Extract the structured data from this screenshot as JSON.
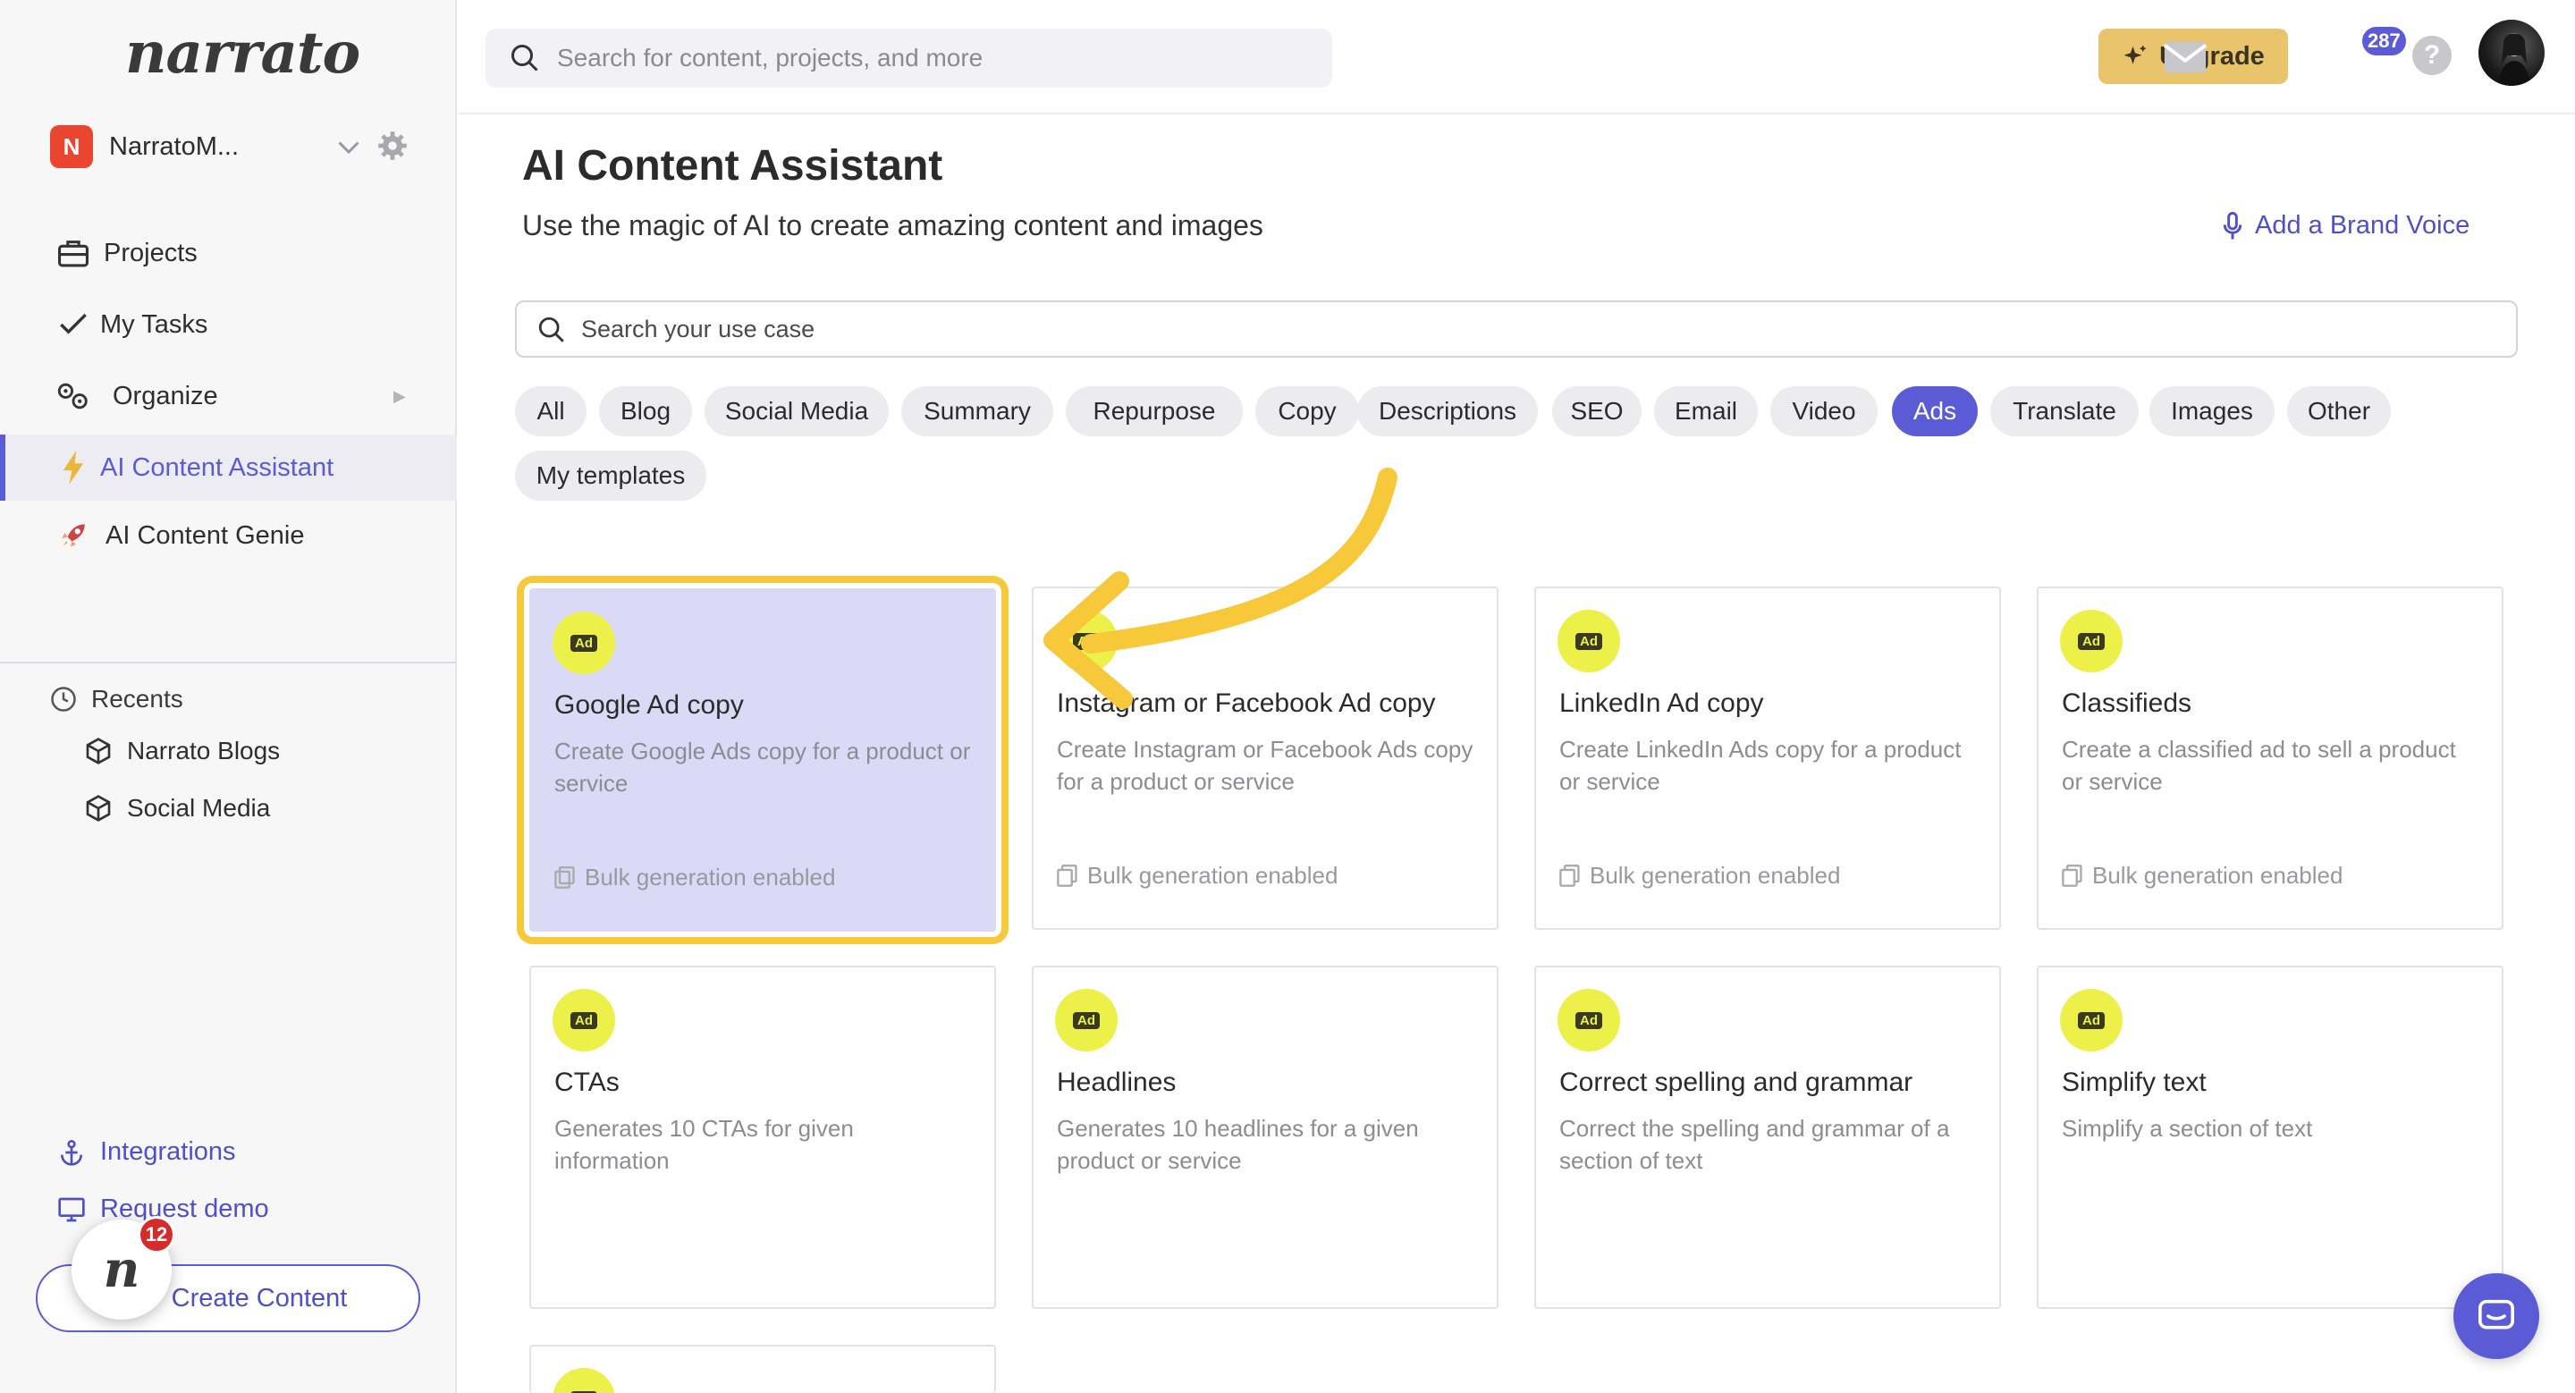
{
  "sidebar": {
    "logo": "narrato",
    "workspace": {
      "initial": "N",
      "name": "NarratoM..."
    },
    "nav": [
      {
        "label": "Projects",
        "icon": "briefcase-icon"
      },
      {
        "label": "My Tasks",
        "icon": "check-icon"
      },
      {
        "label": "Organize",
        "icon": "gears-icon"
      },
      {
        "label": "AI Content Assistant",
        "icon": "lightning-icon"
      },
      {
        "label": "AI Content Genie",
        "icon": "rocket-icon"
      }
    ],
    "recents_title": "Recents",
    "recents": [
      "Narrato Blogs",
      "Social Media"
    ],
    "integrations": "Integrations",
    "request_demo": "Request demo",
    "create_content": "Create Content",
    "notification_count": "12"
  },
  "topbar": {
    "search_placeholder": "Search for content, projects, and more",
    "upgrade": "Upgrade",
    "mail_count": "287",
    "help": "?"
  },
  "main": {
    "title": "AI Content Assistant",
    "subtitle": "Use the magic of AI to create amazing content and images",
    "brand_voice": "Add a Brand Voice",
    "usecase_placeholder": "Search your use case",
    "chips": [
      "All",
      "Blog",
      "Social Media",
      "Summary",
      "Repurpose",
      "Copy",
      "Descriptions",
      "SEO",
      "Email",
      "Video",
      "Ads",
      "Translate",
      "Images",
      "Other",
      "My templates"
    ],
    "active_chip": "Ads",
    "cards": [
      {
        "badge": "Ad",
        "title": "Google Ad copy",
        "desc": "Create Google Ads copy for a product or service",
        "bulk": "Bulk generation enabled"
      },
      {
        "badge": "Ad",
        "title": "Instagram or Facebook Ad copy",
        "desc": "Create Instagram or Facebook Ads copy for a product or service",
        "bulk": "Bulk generation enabled"
      },
      {
        "badge": "Ad",
        "title": "LinkedIn Ad copy",
        "desc": "Create LinkedIn Ads copy for a product or service",
        "bulk": "Bulk generation enabled"
      },
      {
        "badge": "Ad",
        "title": "Classifieds",
        "desc": "Create a classified ad to sell a product or service",
        "bulk": "Bulk generation enabled"
      },
      {
        "badge": "Ad",
        "title": "CTAs",
        "desc": "Generates 10 CTAs for given information"
      },
      {
        "badge": "Ad",
        "title": "Headlines",
        "desc": "Generates 10 headlines for a given product or service"
      },
      {
        "badge": "Ad",
        "title": "Correct spelling and grammar",
        "desc": "Correct the spelling and grammar of a section of text"
      },
      {
        "badge": "Ad",
        "title": "Simplify text",
        "desc": "Simplify a section of text"
      },
      {
        "badge": "Ad"
      }
    ]
  },
  "colors": {
    "accent": "#5b5bd6",
    "highlight": "#f6c83a",
    "upgrade": "#e9c46a",
    "ad_badge": "#eef04a"
  }
}
